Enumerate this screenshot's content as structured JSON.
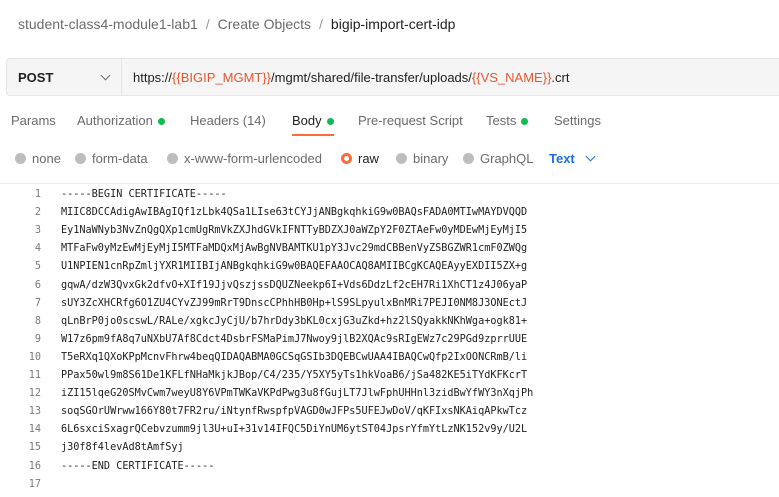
{
  "breadcrumb": [
    "student-class4-module1-lab1",
    "Create Objects",
    "bigip-import-cert-idp"
  ],
  "request": {
    "method": "POST",
    "url_parts": [
      {
        "text": "https://",
        "var": false
      },
      {
        "text": "{{BIGIP_MGMT}}",
        "var": true
      },
      {
        "text": "/mgmt/shared/file-transfer/uploads/",
        "var": false
      },
      {
        "text": "{{VS_NAME}}",
        "var": true
      },
      {
        "text": ".crt",
        "var": false
      }
    ]
  },
  "tabs": [
    {
      "label": "Params",
      "dot": false,
      "active": false
    },
    {
      "label": "Authorization",
      "dot": true,
      "active": false
    },
    {
      "label": "Headers (14)",
      "dot": false,
      "active": false
    },
    {
      "label": "Body",
      "dot": true,
      "active": true
    },
    {
      "label": "Pre-request Script",
      "dot": false,
      "active": false
    },
    {
      "label": "Tests",
      "dot": true,
      "active": false
    },
    {
      "label": "Settings",
      "dot": false,
      "active": false
    }
  ],
  "body_types": [
    {
      "label": "none",
      "checked": false
    },
    {
      "label": "form-data",
      "checked": false
    },
    {
      "label": "x-www-form-urlencoded",
      "checked": false
    },
    {
      "label": "raw",
      "checked": true
    },
    {
      "label": "binary",
      "checked": false
    },
    {
      "label": "GraphQL",
      "checked": false
    }
  ],
  "raw_type": "Text",
  "colors": {
    "accent": "#ff6c37",
    "variable": "#e4572e",
    "dot": "#0cbb52",
    "link": "#1d6ed8"
  },
  "editor_lines": [
    "-----BEGIN CERTIFICATE-----",
    "MIIC8DCCAdigAwIBAgIQf1zLbk4QSa1LIse63tCYJjANBgkqhkiG9w0BAQsFADA0MTIwMAYDVQQD",
    "Ey1NaWNyb3NvZnQgQXp1cmUgRmVkZXJhdGVkIFNTTyBDZXJ0aWZpY2F0ZTAeFw0yMDEwMjEyMjI5",
    "MTFaFw0yMzEwMjEyMjI5MTFaMDQxMjAwBgNVBAMTKU1pY3Jvc29mdCBBenVyZSBGZWR1cmF0ZWQg",
    "U1NPIEN1cnRpZmljYXR1MIIBIjANBgkqhkiG9w0BAQEFAAOCAQ8AMIIBCgKCAQEAyyEXDII5ZX+g",
    "gqwA/dzW3QvxGk2dfvO+XIf19JjvQszjssDQUZNeekp6I+Vds6DdzLf2cEH7Ri1XhCT1z4J06yaP",
    "sUY3ZcXHCRfg6O1ZU4CYvZJ99mRrT9DnscCPhhHB0Hp+lS9SLpyulxBnMRi7PEJI0NM8J3ONEctJ",
    "qLnBrP0jo0scswL/RALe/xgkcJyCjU/b7hrDdy3bKL0cxjG3uZkd+hz2lSQyakkNKhWga+ogk81+",
    "W17z6pm9fA8q7uNXbU7Af8Cdct4DsbrFSMaPimJ7Nwoy9jlB2XQAc9sRIgEWz7c29PGd9zprrUUE",
    "T5eRXq1QXoKPpMcnvFhrw4beqQIDAQABMA0GCSqGSIb3DQEBCwUAA4IBAQCwQfp2IxOONCRmB/li",
    "PPax50wl9m8S61De1KFLfNHaMkjkJBop/C4/235/Y5XY5yTs1hkVoaB6/jSa482KE5iTYdKFKcrT",
    "iZI15lqeG20SMvCwm7weyU8Y6VPmTWKaVKPdPwg3u8fGujLT7JlwFphUHHnl3zidBwYfWY3nXqjPh",
    "soqSGOrUWrww166Y80t7FR2ru/iNtynfRwspfpVAGD0wJFPs5UFEJwDoV/qKFIxsNKAiqAPkwTcz",
    "6L6sxciSxagrQCebvzumm9jl3U+uI+31v14IFQC5DiYnUM6ytST04JpsrYfmYtLzNK152v9y/U2L",
    "j30f8f4levAd8tAmfSyj",
    "-----END CERTIFICATE-----",
    ""
  ]
}
